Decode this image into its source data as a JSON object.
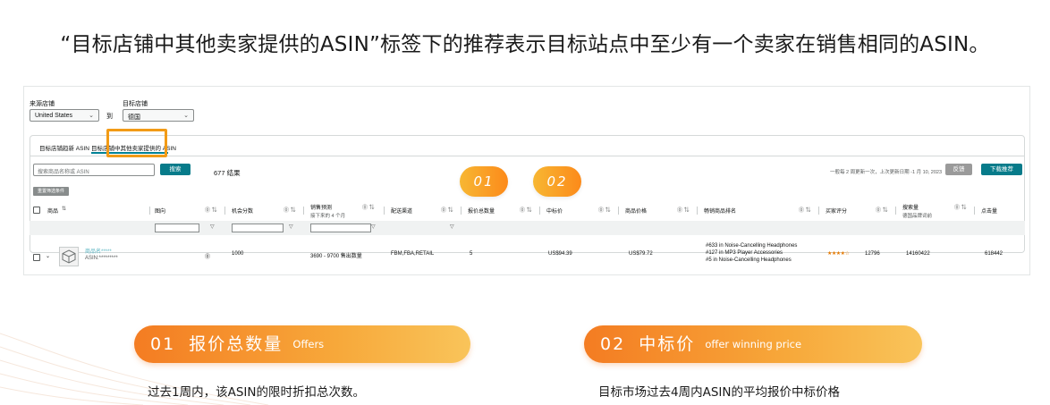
{
  "headline": "“目标店铺中其他卖家提供的ASIN”标签下的推荐表示目标站点中至少有一个卖家在销售相同的ASIN。",
  "screenshot": {
    "source_store_label": "来源店铺",
    "source_store_value": "United States",
    "to_label": "到",
    "target_store_label": "目标店铺",
    "target_store_value": "德国",
    "tabs": [
      {
        "label": "目标店铺趋新 ASIN",
        "active": false
      },
      {
        "label": "目标店铺中其他卖家提供的 ASIN",
        "active": true
      }
    ],
    "search_placeholder": "搜索商品名称或 ASIN",
    "search_button": "搜索",
    "result_count": "677 结果",
    "update_note": "一般每 2 周更新一次，上次更新日期 -1 月 10, 2023",
    "feedback_button": "反馈",
    "download_button": "下载推荐",
    "reset_filters": "重置筛选条件",
    "columns": {
      "product": "商品",
      "brand": "图向",
      "opportunity_score": "机会分数",
      "sales_forecast": "销售预测",
      "sales_forecast_sub": "接下来的 4 个月",
      "fulfillment": "配送渠道",
      "offer_count": "报价总数量",
      "winning_price": "中标价",
      "product_price": "商品价格",
      "bestseller_rank": "畅销商品排名",
      "rating": "买家评分",
      "search_volume": "搜索量",
      "search_volume_sub": "德国品牌词前",
      "clicks": "点击量"
    },
    "row": {
      "product_name": "商品名*****",
      "asin": "ASIN:*********",
      "opportunity_score": "1000",
      "sales_forecast": "3690 - 9700 售出数量",
      "fulfillment": "FBM,FBA,RETAIL",
      "offer_count": "5",
      "winning_price": "US$94.39",
      "product_price": "US$79.72",
      "rank_lines": [
        "#633 in Noise-Cancelling Headphones",
        "#127 in MP3 Player Accessories",
        "#5 in Noise-Cancelling Headphones"
      ],
      "rating_stars": "★★★★☆",
      "rating_count": "12796",
      "search_volume": "14160422",
      "clicks": "618442"
    }
  },
  "markers": {
    "m1": "01",
    "m2": "02"
  },
  "callouts": [
    {
      "num": "01",
      "title": "报价总数量",
      "subtitle": "Offers",
      "description": "过去1周内，该ASIN的限时折扣总次数。"
    },
    {
      "num": "02",
      "title": "中标价",
      "subtitle": "offer winning price",
      "description": "目标市场过去4周内ASIN的平均报价中标价格"
    }
  ],
  "colors": {
    "accent": "#f7931e",
    "teal": "#077b8a",
    "pill_start": "#f47c22",
    "pill_end": "#f9c45a"
  }
}
